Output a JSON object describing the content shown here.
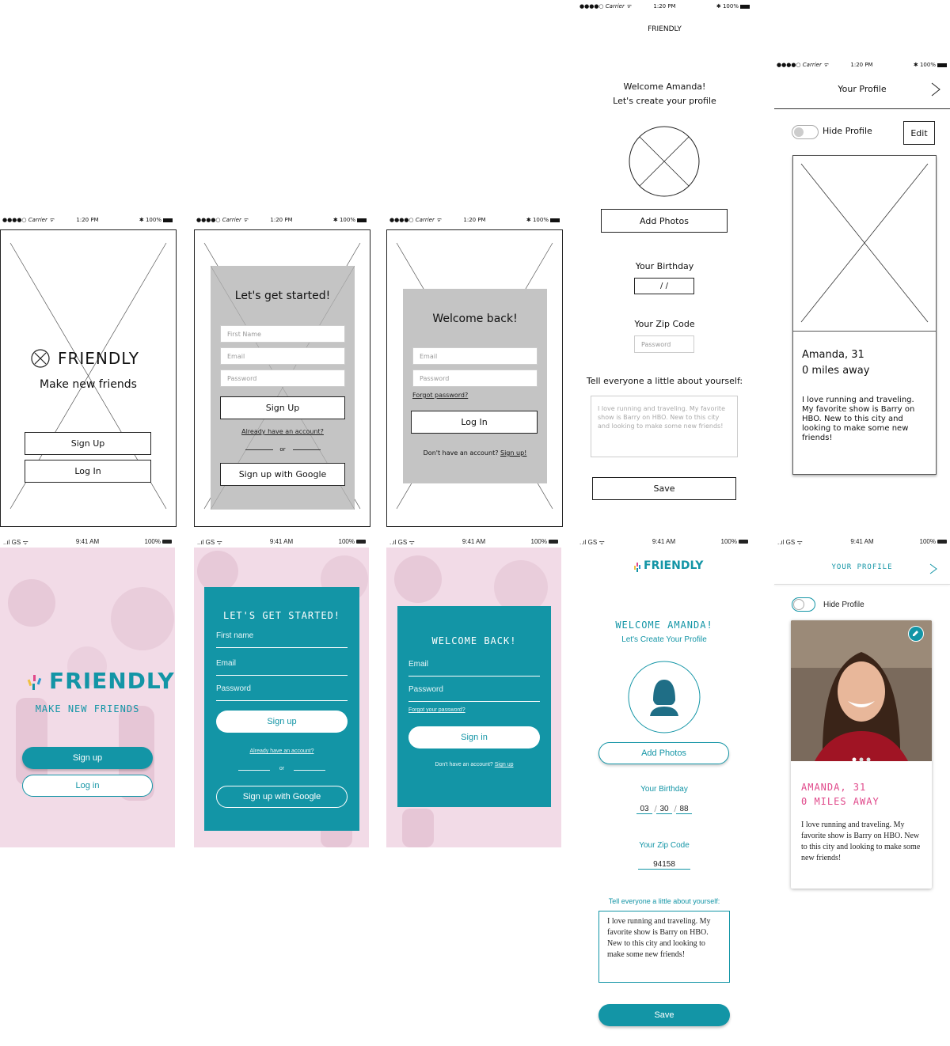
{
  "wireframe_status": {
    "carrier": "●●●●○ Carrier ᯤ",
    "time": "1:20 PM",
    "battery": "✱ 100%"
  },
  "hifi_status": {
    "signal": "..ıl GS ᯤ",
    "time": "9:41 AM",
    "battery": "100%"
  },
  "wf_splash": {
    "brand": "FRIENDLY",
    "tagline": "Make new friends",
    "signup": "Sign Up",
    "login": "Log In"
  },
  "wf_signup": {
    "title": "Let's get started!",
    "first_name": "First Name",
    "email": "Email",
    "password": "Password",
    "signup": "Sign Up",
    "have_account": "Already have an account?",
    "or": "or",
    "google": "Sign up with Google"
  },
  "wf_login": {
    "title": "Welcome back!",
    "email": "Email",
    "password": "Password",
    "forgot": "Forgot password?",
    "login": "Log In",
    "no_account": "Don't have an account?",
    "signup_link": "Sign up!"
  },
  "wf_create": {
    "header": "FRIENDLY",
    "welcome": "Welcome Amanda!",
    "subtitle": "Let's create your profile",
    "add_photos": "Add Photos",
    "birthday_label": "Your Birthday",
    "birthday_value": "/ /",
    "zip_label": "Your Zip Code",
    "zip_placeholder": "Password",
    "about_label": "Tell everyone a little about yourself:",
    "about_text": "I love running and traveling. My favorite show is Barry on HBO. New to this city and looking to make some new friends!",
    "save": "Save"
  },
  "wf_profile": {
    "title": "Your Profile",
    "hide": "Hide Profile",
    "edit": "Edit",
    "name_age": "Amanda, 31",
    "distance": "0 miles away",
    "bio": "I love running and traveling. My favorite show is Barry on HBO. New to this city and looking to make some new friends!"
  },
  "hf_splash": {
    "brand": "FRIENDLY",
    "tagline": "MAKE NEW FRIENDS",
    "signup": "Sign up",
    "login": "Log in"
  },
  "hf_signup": {
    "title": "LET'S GET STARTED!",
    "first_name": "First name",
    "email": "Email",
    "password": "Password",
    "signup": "Sign up",
    "have_account": "Already have an account?",
    "or": "or",
    "google": "Sign up with Google"
  },
  "hf_login": {
    "title": "WELCOME BACK!",
    "email": "Email",
    "password": "Password",
    "forgot": "Forgot your password?",
    "signin": "Sign in",
    "no_account": "Don't have an account?",
    "signup_link": "Sign up"
  },
  "hf_create": {
    "brand": "FRIENDLY",
    "welcome": "WELCOME AMANDA!",
    "subtitle": "Let's Create Your Profile",
    "add_photos": "Add Photos",
    "birthday_label": "Your Birthday",
    "bd_month": "03",
    "bd_day": "30",
    "bd_year": "88",
    "bd_sep": "/",
    "zip_label": "Your Zip Code",
    "zip_value": "94158",
    "about_label": "Tell everyone a little about yourself:",
    "about_text": "I love running and traveling. My favorite show is Barry on HBO. New to this city and looking to make some new friends!",
    "save": "Save"
  },
  "hf_profile": {
    "title": "YOUR PROFILE",
    "hide": "Hide Profile",
    "name_age": "AMANDA, 31",
    "distance": "0 MILES AWAY",
    "bio": "I love running and traveling. My favorite show is Barry on HBO. New to this city and looking to make some new friends!"
  },
  "colors": {
    "teal": "#1395a6",
    "pink_bg": "#f2dbe7",
    "pink_accent": "#e0488a",
    "wire_grey": "#c4c4c4"
  }
}
